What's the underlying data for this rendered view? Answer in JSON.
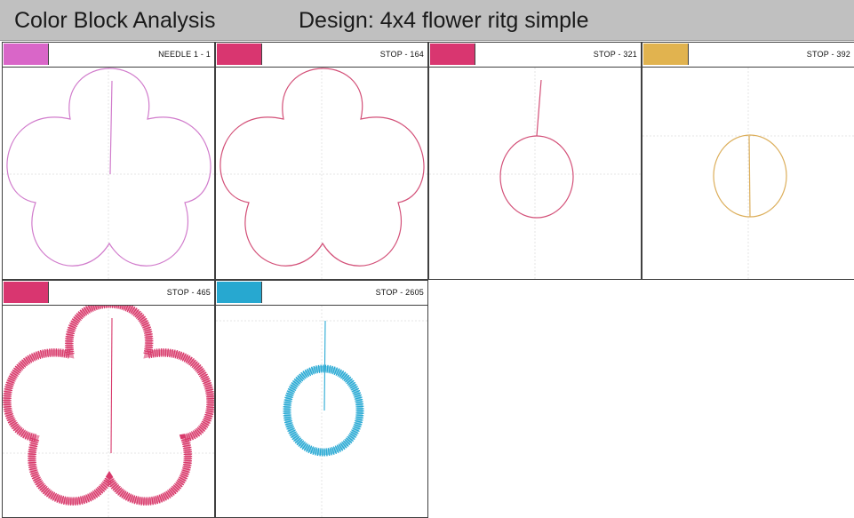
{
  "header": {
    "title": "Color Block Analysis",
    "design": "Design: 4x4 flower ritg simple"
  },
  "blocks": [
    {
      "label": "NEEDLE 1 - 1",
      "swatch_color": "#d966c8",
      "thread_color": "#d17ccc",
      "shape": "flower-outline"
    },
    {
      "label": "STOP - 164",
      "swatch_color": "#d93670",
      "thread_color": "#d35078",
      "shape": "flower-outline"
    },
    {
      "label": "STOP - 321",
      "swatch_color": "#d93670",
      "thread_color": "#d35078",
      "shape": "oval-outline"
    },
    {
      "label": "STOP - 392",
      "swatch_color": "#e1b34f",
      "thread_color": "#dcae5a",
      "shape": "oval-outline"
    },
    {
      "label": "STOP - 465",
      "swatch_color": "#d93670",
      "thread_color": "#d83a6c",
      "shape": "flower-satin"
    },
    {
      "label": "STOP - 2605",
      "swatch_color": "#27a8d0",
      "thread_color": "#2aaad4",
      "shape": "oval-satin"
    }
  ]
}
